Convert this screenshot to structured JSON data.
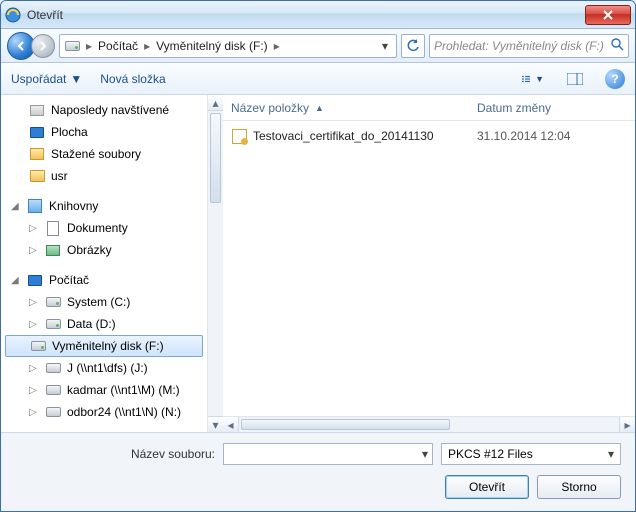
{
  "window": {
    "title": "Otevřít"
  },
  "nav": {
    "back_tip": "Zpět",
    "forward_tip": "Vpřed",
    "refresh_tip": "Aktualizovat",
    "breadcrumb": {
      "root": "Počítač",
      "current": "Vyměnitelný disk (F:)"
    },
    "search_placeholder": "Prohledat: Vyměnitelný disk (F:)"
  },
  "toolbar": {
    "organize": "Uspořádat",
    "new_folder": "Nová složka",
    "view_tip": "Zobrazit",
    "preview_tip": "Náhled",
    "help_tip": "Nápověda"
  },
  "tree": {
    "recent": "Naposledy navštívené",
    "desktop": "Plocha",
    "downloads": "Stažené soubory",
    "usr": "usr",
    "libraries": "Knihovny",
    "documents": "Dokumenty",
    "pictures": "Obrázky",
    "computer": "Počítač",
    "system_c": "System (C:)",
    "data_d": "Data (D:)",
    "removable_f": "Vyměnitelný disk (F:)",
    "net_j": "J (\\\\nt1\\dfs) (J:)",
    "net_m": "kadmar (\\\\nt1\\M) (M:)",
    "net_n": "odbor24 (\\\\nt1\\N) (N:)"
  },
  "files": {
    "col_name": "Název položky",
    "col_date": "Datum změny",
    "rows": [
      {
        "name": "Testovaci_certifikat_do_20141130",
        "date": "31.10.2014 12:04"
      }
    ]
  },
  "footer": {
    "filename_label": "Název souboru:",
    "filename_value": "",
    "filter": "PKCS #12 Files",
    "open": "Otevřít",
    "cancel": "Storno"
  }
}
